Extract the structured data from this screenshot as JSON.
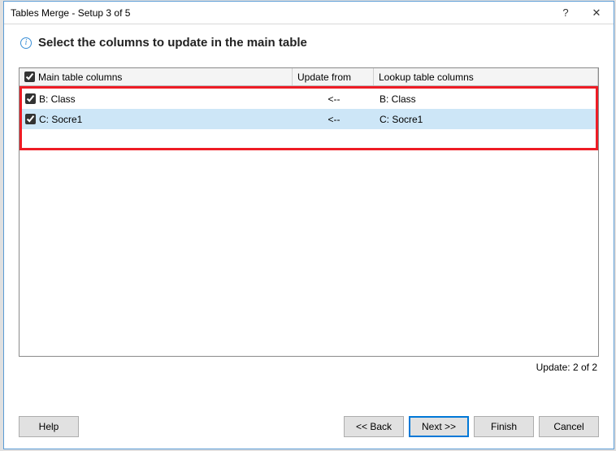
{
  "titlebar": {
    "title": "Tables Merge - Setup 3 of 5",
    "help_symbol": "?",
    "close_symbol": "✕"
  },
  "instruction": "Select the columns to update in the main table",
  "info_icon_glyph": "i",
  "table": {
    "headers": {
      "main": "Main table columns",
      "update": "Update from",
      "lookup": "Lookup table columns"
    },
    "rows": [
      {
        "main": "B: Class",
        "update": "<--",
        "lookup": "B: Class",
        "checked": true
      },
      {
        "main": "C: Socre1",
        "update": "<--",
        "lookup": "C: Socre1",
        "checked": true
      }
    ]
  },
  "status": "Update: 2 of 2",
  "buttons": {
    "help": "Help",
    "back": "<< Back",
    "next": "Next >>",
    "finish": "Finish",
    "cancel": "Cancel"
  }
}
